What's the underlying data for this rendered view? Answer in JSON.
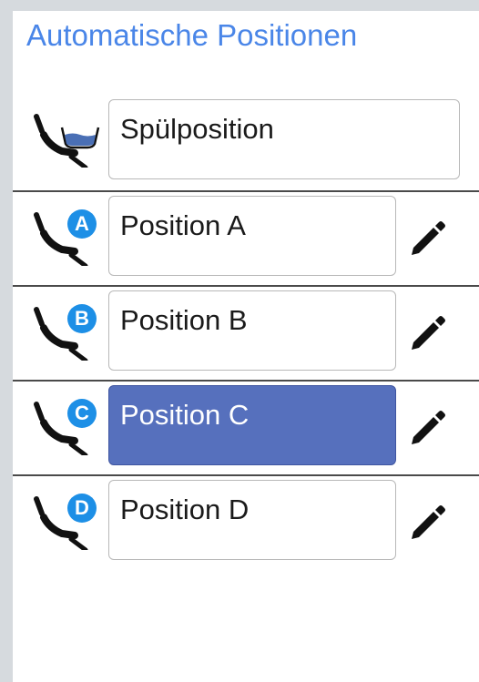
{
  "header": {
    "title": "Automatische Positionen"
  },
  "rinse": {
    "label": "Spülposition",
    "icon": "chair-rinse-icon"
  },
  "positions": [
    {
      "badge": "A",
      "label": "Position A",
      "selected": false
    },
    {
      "badge": "B",
      "label": "Position B",
      "selected": false
    },
    {
      "badge": "C",
      "label": "Position C",
      "selected": true
    },
    {
      "badge": "D",
      "label": "Position D",
      "selected": false
    }
  ],
  "colors": {
    "accent": "#4a86e8",
    "badge": "#1d8fe6",
    "selected_field": "#5670bd",
    "water": "#4a6fb5"
  },
  "icons": {
    "edit": "pencil-icon",
    "chair": "dental-chair-icon"
  }
}
